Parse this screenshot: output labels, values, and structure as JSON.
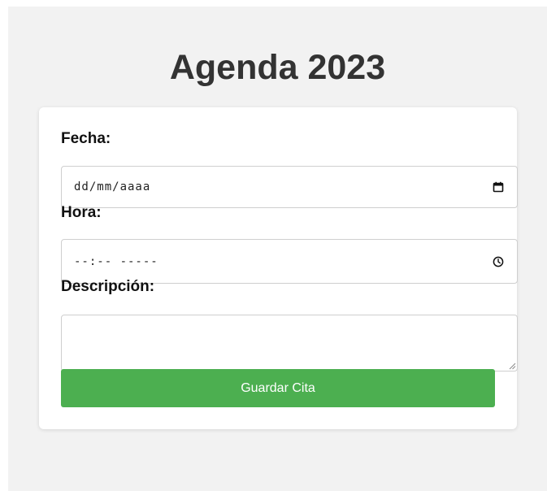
{
  "page": {
    "title": "Agenda 2023"
  },
  "form": {
    "fecha": {
      "label": "Fecha:",
      "placeholder": "dd/mm/aaaa",
      "icon": "calendar-icon"
    },
    "hora": {
      "label": "Hora:",
      "placeholder": "--:-- -----",
      "icon": "clock-icon"
    },
    "descripcion": {
      "label": "Descripción:",
      "value": ""
    },
    "submit_label": "Guardar Cita"
  },
  "colors": {
    "background": "#f2f2f2",
    "card": "#ffffff",
    "button": "#4caf50",
    "button_text": "#ffffff",
    "title": "#333333"
  }
}
